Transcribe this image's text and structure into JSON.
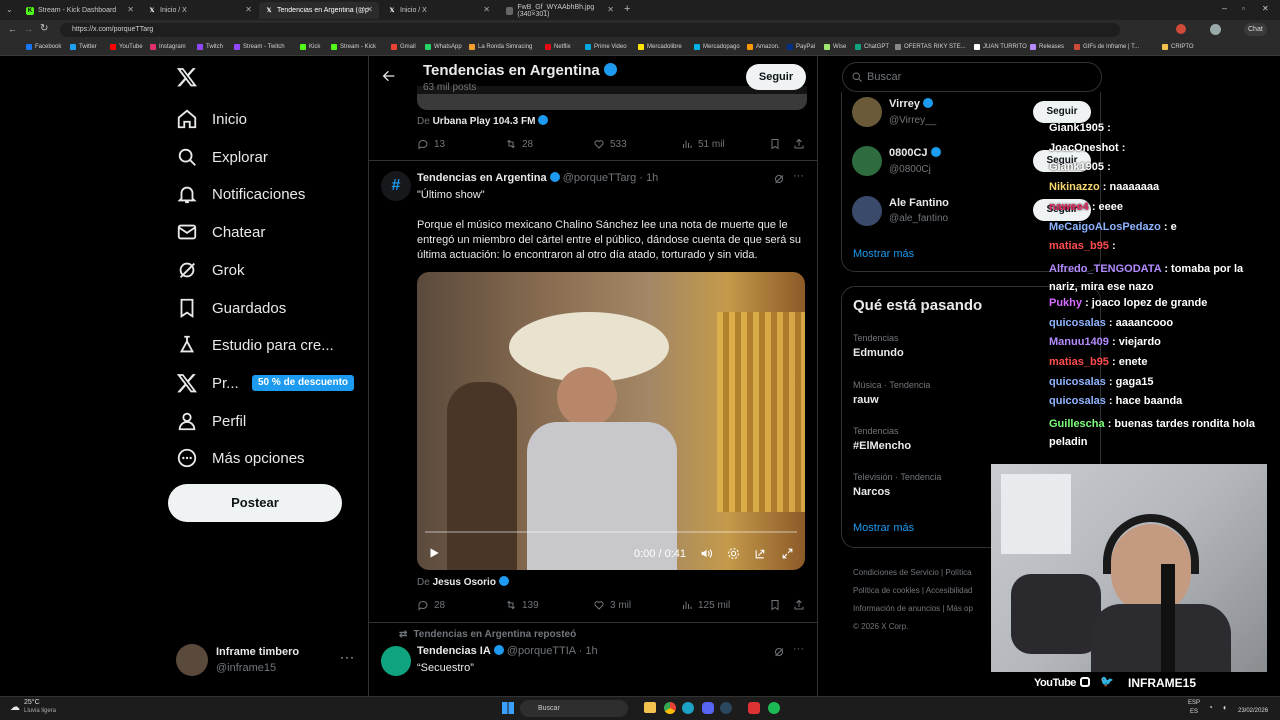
{
  "browser": {
    "tabs": [
      {
        "title": "Stream - Kick Dashboard",
        "favicon": "kick-icon"
      },
      {
        "title": "Inicio / X",
        "favicon": "x-icon"
      },
      {
        "title": "Tendencias en Argentina (@porqu…",
        "favicon": "x-icon"
      },
      {
        "title": "Inicio / X",
        "favicon": "x-icon"
      },
      {
        "title": "FwB_Gf_WYAAbhBh.jpg (340×301)",
        "favicon": "image-icon"
      }
    ],
    "url": "https://x.com/porqueTTarg",
    "profile_label": "Chat",
    "bookmarks": [
      "Facebook",
      "Twitter",
      "YouTube",
      "Instagram",
      "Twitch",
      "Stream - Twitch",
      "Kick",
      "Stream - Kick",
      "Gmail",
      "WhatsApp",
      "La Ronda Simracing",
      "Netflix",
      "Prime Video",
      "Mercadolibre",
      "Mercadopago",
      "Amazon.",
      "PayPal",
      "Wise",
      "ChatGPT",
      "OFERTAS RIKY STE...",
      "JUAN TURRITO",
      "Releases",
      "GIFs de Inframe | T...",
      "CRIPTO"
    ]
  },
  "sidebar": {
    "items": [
      {
        "label": "Inicio",
        "icon": "home-icon"
      },
      {
        "label": "Explorar",
        "icon": "search-icon"
      },
      {
        "label": "Notificaciones",
        "icon": "bell-icon"
      },
      {
        "label": "Chatear",
        "icon": "mail-icon"
      },
      {
        "label": "Grok",
        "icon": "grok-icon"
      },
      {
        "label": "Guardados",
        "icon": "bookmark-icon"
      },
      {
        "label": "Estudio para cre...",
        "icon": "creator-studio-icon"
      },
      {
        "label": "Pr...",
        "icon": "x-premium-icon"
      },
      {
        "label": "Perfil",
        "icon": "person-icon"
      },
      {
        "label": "Más opciones",
        "icon": "more-circle-icon"
      }
    ],
    "premium_badge": "50 % de descuento",
    "post_label": "Postear",
    "account": {
      "name": "Inframe timbero",
      "handle": "@inframe15"
    }
  },
  "header": {
    "title": "Tendencias en Argentina",
    "subtitle": "63 mil posts",
    "follow_label": "Seguir"
  },
  "tweet_prev": {
    "from_prefix": "De",
    "from_name": "Urbana Play 104.3 FM",
    "replies": "13",
    "retweets": "28",
    "likes": "533",
    "views": "51 mil"
  },
  "tweet_main": {
    "name": "Tendencias en Argentina",
    "handle": "@porqueTTarg",
    "time": "1h",
    "title": "\"Último show\"",
    "body": "Porque el músico mexicano Chalino Sánchez lee una nota de muerte que le entregó un miembro del cártel entre el público, dándose cuenta de que será su última actuación: lo encontraron al otro día atado, torturado y sin vida.",
    "video_time": "0:00 / 0:41",
    "video_progress": 0,
    "from_prefix": "De",
    "from_name": "Jesus Osorio",
    "replies": "28",
    "retweets": "139",
    "likes": "3 mil",
    "views": "125 mil"
  },
  "tweet_next": {
    "repost_note": "Tendencias en Argentina reposteó",
    "name": "Tendencias IA",
    "handle": "@porqueTTIA",
    "time": "1h",
    "title": "“Secuestro”"
  },
  "right": {
    "search_placeholder": "Buscar",
    "who_to_follow": [
      {
        "name": "Virrey",
        "handle": "@Virrey__"
      },
      {
        "name": "0800CJ",
        "handle": "@0800Cj"
      },
      {
        "name": "Ale Fantino",
        "handle": "@ale_fantino"
      }
    ],
    "follow_label": "Seguir",
    "show_more": "Mostrar más",
    "trends_title": "Qué está pasando",
    "trends": [
      {
        "context": "Tendencias",
        "name": "Edmundo"
      },
      {
        "context": "Música · Tendencia",
        "name": "rauw"
      },
      {
        "context": "Tendencias",
        "name": "#ElMencho"
      },
      {
        "context": "Televisión · Tendencia",
        "name": "Narcos"
      }
    ],
    "show_more_2": "Mostrar más",
    "footer": [
      "Condiciones de Servicio",
      "Política",
      "Política de cookies",
      "Accesibilidad",
      "Información de anuncios",
      "Más op",
      "© 2026 X Corp."
    ]
  },
  "chat": {
    "messages": [
      {
        "user": "Giank1905",
        "text": ":",
        "color": "#ffffff"
      },
      {
        "user": "JoacOneshot",
        "text": ":",
        "color": "#ffffff"
      },
      {
        "user": "Giank1905",
        "text": ":",
        "color": "#ffffff"
      },
      {
        "user": "Nikinazzo",
        "text": ": naaaaaaa",
        "color": "#f5d76e"
      },
      {
        "user": "nawee4",
        "text": ": eeee",
        "color": "#e0245e"
      },
      {
        "user": "MeCaigoALosPedazo",
        "text": ": e",
        "color": "#8fb4ff"
      },
      {
        "user": "matias_b95",
        "text": ":",
        "color": "#ff4d4d"
      },
      {
        "user": "Alfredo_TENGODATA",
        "text": ": tomaba por la nariz, mira ese nazo",
        "color": "#b48cff"
      },
      {
        "user": "Pukhy",
        "text": ": joaco lopez de grande",
        "color": "#d66bff"
      },
      {
        "user": "quicosalas",
        "text": ": aaaancooo",
        "color": "#8fb4ff"
      },
      {
        "user": "Manuu1409",
        "text": ": viejardo",
        "color": "#b48cff"
      },
      {
        "user": "matias_b95",
        "text": ": enete",
        "color": "#ff4d4d"
      },
      {
        "user": "quicosalas",
        "text": ": gaga15",
        "color": "#8fb4ff"
      },
      {
        "user": "quicosalas",
        "text": ": hace baanda",
        "color": "#8fb4ff"
      },
      {
        "user": "Guillescha",
        "text": ": buenas tardes rondita hola peladin",
        "color": "#7dff7d"
      }
    ]
  },
  "webcam": {
    "socials": [
      "YouTube",
      "INFRAME15"
    ]
  },
  "taskbar": {
    "weather_temp": "25°C",
    "weather_text": "Lluvia ligera",
    "search": "Buscar",
    "lang": "ESP",
    "region": "ES",
    "date": "23/02/2026"
  },
  "colors": {
    "accent": "#1d9bf0",
    "bg": "#000000",
    "border": "#2f3336",
    "muted": "#71767b"
  }
}
